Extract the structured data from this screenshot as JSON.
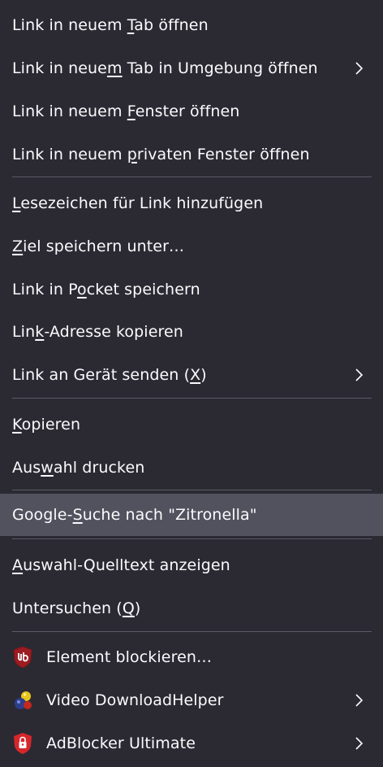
{
  "menu": {
    "items": [
      {
        "pre": "Link in neuem ",
        "u": "T",
        "post": "ab öffnen",
        "sub": false
      },
      {
        "pre": "Link in neue",
        "u": "m",
        "post": " Tab in Umgebung öffnen",
        "sub": true
      },
      {
        "pre": "Link in neuem ",
        "u": "F",
        "post": "enster öffnen",
        "sub": false
      },
      {
        "pre": "Link in neuem ",
        "u": "p",
        "post": "rivaten Fenster öffnen",
        "sub": false
      },
      {
        "pre": "",
        "u": "L",
        "post": "esezeichen für Link hinzufügen",
        "sub": false
      },
      {
        "pre": "",
        "u": "Z",
        "post": "iel speichern unter…",
        "sub": false
      },
      {
        "pre": "Link in P",
        "u": "o",
        "post": "cket speichern",
        "sub": false
      },
      {
        "pre": "Lin",
        "u": "k",
        "post": "-Adresse kopieren",
        "sub": false
      },
      {
        "pre": "Link an Gerät senden (",
        "u": "X",
        "post": ")",
        "sub": true
      },
      {
        "pre": "",
        "u": "K",
        "post": "opieren",
        "sub": false
      },
      {
        "pre": "Aus",
        "u": "w",
        "post": "ahl drucken",
        "sub": false
      },
      {
        "pre": "Google-",
        "u": "S",
        "post": "uche nach \"Zitronella\"",
        "sub": false
      },
      {
        "pre": "",
        "u": "A",
        "post": "uswahl-Quelltext anzeigen",
        "sub": false
      },
      {
        "pre": "Untersuchen (",
        "u": "Q",
        "post": ")",
        "sub": false
      }
    ],
    "extensions": [
      {
        "label": "Element blockieren…",
        "icon": "ublock-origin-icon",
        "sub": false
      },
      {
        "label": "Video DownloadHelper",
        "icon": "video-downloadhelper-icon",
        "sub": true
      },
      {
        "label": "AdBlocker Ultimate",
        "icon": "adblocker-ultimate-icon",
        "sub": true
      }
    ],
    "colors": {
      "background": "#2b2a33",
      "highlight": "#52525e",
      "text": "#fbfbfe",
      "separator": "#5b5b66",
      "shield_red": "#9b1c22"
    }
  }
}
